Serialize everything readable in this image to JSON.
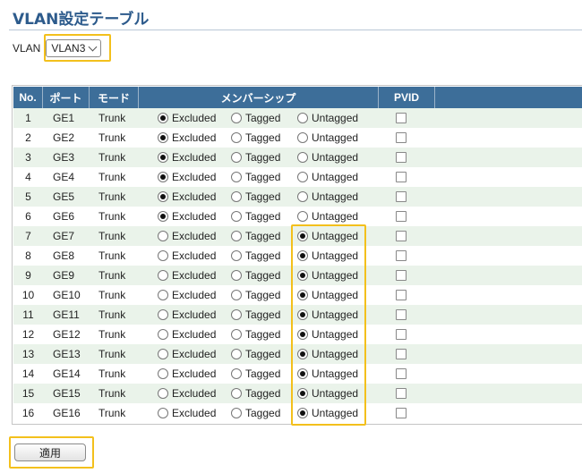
{
  "page": {
    "title": "VLAN設定テーブル"
  },
  "vlan": {
    "label": "VLAN",
    "selected": "VLAN3"
  },
  "table": {
    "headers": {
      "no": "No.",
      "port": "ポート",
      "mode": "モード",
      "membership": "メンバーシップ",
      "pvid": "PVID"
    },
    "options": {
      "excluded": "Excluded",
      "tagged": "Tagged",
      "untagged": "Untagged"
    },
    "rows": [
      {
        "no": "1",
        "port": "GE1",
        "mode": "Trunk",
        "member": "excluded",
        "pvid": false
      },
      {
        "no": "2",
        "port": "GE2",
        "mode": "Trunk",
        "member": "excluded",
        "pvid": false
      },
      {
        "no": "3",
        "port": "GE3",
        "mode": "Trunk",
        "member": "excluded",
        "pvid": false
      },
      {
        "no": "4",
        "port": "GE4",
        "mode": "Trunk",
        "member": "excluded",
        "pvid": false
      },
      {
        "no": "5",
        "port": "GE5",
        "mode": "Trunk",
        "member": "excluded",
        "pvid": false
      },
      {
        "no": "6",
        "port": "GE6",
        "mode": "Trunk",
        "member": "excluded",
        "pvid": false
      },
      {
        "no": "7",
        "port": "GE7",
        "mode": "Trunk",
        "member": "untagged",
        "pvid": false
      },
      {
        "no": "8",
        "port": "GE8",
        "mode": "Trunk",
        "member": "untagged",
        "pvid": false
      },
      {
        "no": "9",
        "port": "GE9",
        "mode": "Trunk",
        "member": "untagged",
        "pvid": false
      },
      {
        "no": "10",
        "port": "GE10",
        "mode": "Trunk",
        "member": "untagged",
        "pvid": false
      },
      {
        "no": "11",
        "port": "GE11",
        "mode": "Trunk",
        "member": "untagged",
        "pvid": false
      },
      {
        "no": "12",
        "port": "GE12",
        "mode": "Trunk",
        "member": "untagged",
        "pvid": false
      },
      {
        "no": "13",
        "port": "GE13",
        "mode": "Trunk",
        "member": "untagged",
        "pvid": false
      },
      {
        "no": "14",
        "port": "GE14",
        "mode": "Trunk",
        "member": "untagged",
        "pvid": false
      },
      {
        "no": "15",
        "port": "GE15",
        "mode": "Trunk",
        "member": "untagged",
        "pvid": false
      },
      {
        "no": "16",
        "port": "GE16",
        "mode": "Trunk",
        "member": "untagged",
        "pvid": false
      }
    ]
  },
  "actions": {
    "apply_label": "適用"
  },
  "colors": {
    "header_bg": "#3d6e99",
    "alt_row": "#eaf3ea",
    "highlight": "#f3c01c",
    "title": "#2d5b8c"
  }
}
